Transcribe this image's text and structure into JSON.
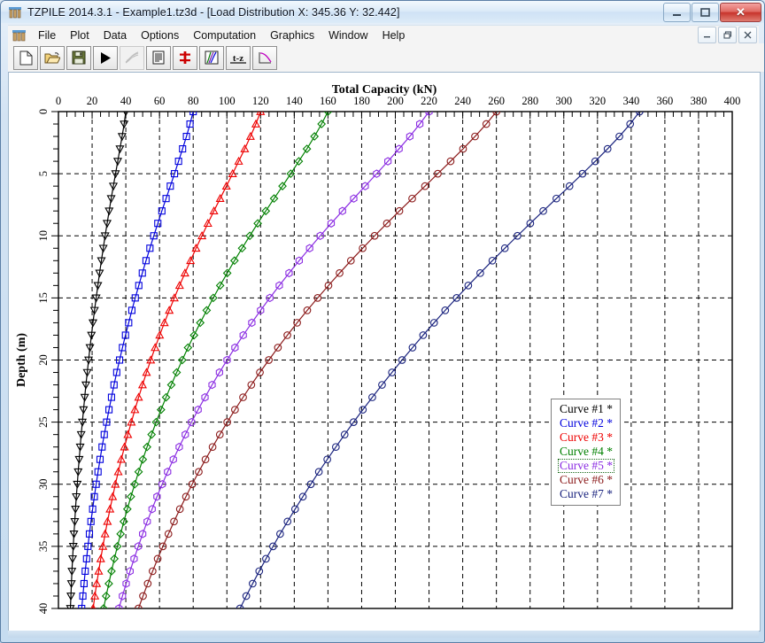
{
  "window": {
    "title": "TZPILE 2014.3.1 - Example1.tz3d - [Load Distribution X: 345.36 Y: 32.442]",
    "app_icon": "tzpile-app-icon",
    "minimize_label": "–",
    "maximize_label": "□",
    "close_label": "✕",
    "mdi_minimize_label": "–",
    "mdi_restore_label": "❐",
    "mdi_close_label": "✕"
  },
  "menu": {
    "items": [
      {
        "label": "File"
      },
      {
        "label": "Plot"
      },
      {
        "label": "Data"
      },
      {
        "label": "Options"
      },
      {
        "label": "Computation"
      },
      {
        "label": "Graphics"
      },
      {
        "label": "Window"
      },
      {
        "label": "Help"
      }
    ]
  },
  "toolbar": {
    "buttons": [
      {
        "icon": "new-file-icon",
        "name": "new-file-button"
      },
      {
        "icon": "open-folder-icon",
        "name": "open-file-button"
      },
      {
        "icon": "save-disk-icon",
        "name": "save-file-button"
      },
      {
        "icon": "run-play-icon",
        "name": "run-computation-button"
      },
      {
        "icon": "curves-disabled-icon",
        "name": "disabled-button"
      },
      {
        "icon": "report-page-icon",
        "name": "report-button"
      },
      {
        "icon": "pile-section-icon",
        "name": "pile-properties-button"
      },
      {
        "icon": "multi-curve-icon",
        "name": "load-distribution-button"
      },
      {
        "icon": "t-z-icon",
        "name": "tz-curve-button"
      },
      {
        "icon": "single-curve-icon",
        "name": "settlement-curve-button"
      }
    ],
    "tz_label": "t-z"
  },
  "chart_data": {
    "type": "line",
    "title": "Total Capacity  (kN)",
    "xlabel": "Total Capacity  (kN)",
    "ylabel": "Depth  (m)",
    "xlim": [
      0,
      400
    ],
    "ylim": [
      0,
      40
    ],
    "y_inverted": true,
    "x_major_step": 20,
    "x_minor_step": 5,
    "y_major_step": 5,
    "y_minor_step": 1,
    "x_ticks": [
      0,
      20,
      40,
      60,
      80,
      100,
      120,
      140,
      160,
      180,
      200,
      220,
      240,
      260,
      280,
      300,
      320,
      340,
      360,
      380,
      400
    ],
    "y_ticks": [
      0,
      5,
      10,
      15,
      20,
      25,
      30,
      35,
      40
    ],
    "grid": "dashed",
    "legend_position": "center-right",
    "legend_selected": "Curve #5 *",
    "series": [
      {
        "name": "Curve #1 *",
        "color": "#000000",
        "marker": "triangle-down",
        "x": [
          40.0,
          39.0,
          37.8,
          36.5,
          35.2,
          33.9,
          32.6,
          31.3,
          30.1,
          28.9,
          27.7,
          26.6,
          25.5,
          24.4,
          23.4,
          22.4,
          21.4,
          20.5,
          19.6,
          18.7,
          17.9,
          17.1,
          16.3,
          15.6,
          14.9,
          14.2,
          13.5,
          12.9,
          12.3,
          11.7,
          11.2,
          10.6,
          10.1,
          9.7,
          9.2,
          8.8,
          8.4,
          8.0,
          7.7,
          7.4,
          7.1
        ],
        "y": [
          0,
          1,
          2,
          3,
          4,
          5,
          6,
          7,
          8,
          9,
          10,
          11,
          12,
          13,
          14,
          15,
          16,
          17,
          18,
          19,
          20,
          21,
          22,
          23,
          24,
          25,
          26,
          27,
          28,
          29,
          30,
          31,
          32,
          33,
          34,
          35,
          36,
          37,
          38,
          39,
          40
        ]
      },
      {
        "name": "Curve #2 *",
        "color": "#0000dd",
        "marker": "square",
        "x": [
          80.0,
          78.1,
          76.0,
          73.7,
          71.3,
          68.9,
          66.4,
          63.9,
          61.4,
          59.0,
          56.6,
          54.3,
          52.0,
          49.8,
          47.7,
          45.6,
          43.6,
          41.7,
          39.8,
          38.0,
          36.3,
          34.6,
          33.0,
          31.5,
          30.0,
          28.6,
          27.2,
          25.9,
          24.7,
          23.5,
          22.4,
          21.3,
          20.3,
          19.3,
          18.4,
          17.5,
          16.7,
          15.9,
          15.2,
          14.5,
          13.8
        ],
        "y": [
          0,
          1,
          2,
          3,
          4,
          5,
          6,
          7,
          8,
          9,
          10,
          11,
          12,
          13,
          14,
          15,
          16,
          17,
          18,
          19,
          20,
          21,
          22,
          23,
          24,
          25,
          26,
          27,
          28,
          29,
          30,
          31,
          32,
          33,
          34,
          35,
          36,
          37,
          38,
          39,
          40
        ]
      },
      {
        "name": "Curve #3 *",
        "color": "#ee0000",
        "marker": "triangle-up",
        "x": [
          120.0,
          117.2,
          114.0,
          110.6,
          107.0,
          103.4,
          99.7,
          96.0,
          92.3,
          88.7,
          85.2,
          81.7,
          78.4,
          75.1,
          71.9,
          68.8,
          65.8,
          62.9,
          60.1,
          57.4,
          54.8,
          52.3,
          49.9,
          47.6,
          45.4,
          43.3,
          41.2,
          39.2,
          37.3,
          35.5,
          33.8,
          32.2,
          30.6,
          29.1,
          27.7,
          26.4,
          25.1,
          23.9,
          22.7,
          21.6,
          20.6
        ],
        "y": [
          0,
          1,
          2,
          3,
          4,
          5,
          6,
          7,
          8,
          9,
          10,
          11,
          12,
          13,
          14,
          15,
          16,
          17,
          18,
          19,
          20,
          21,
          22,
          23,
          24,
          25,
          26,
          27,
          28,
          29,
          30,
          31,
          32,
          33,
          34,
          35,
          36,
          37,
          38,
          39,
          40
        ]
      },
      {
        "name": "Curve #4 *",
        "color": "#008000",
        "marker": "diamond",
        "x": [
          160.0,
          156.2,
          152.0,
          147.5,
          142.7,
          137.9,
          133.0,
          128.0,
          123.1,
          118.3,
          113.6,
          109.0,
          104.5,
          100.2,
          96.0,
          91.9,
          88.0,
          84.2,
          80.5,
          76.9,
          73.5,
          70.2,
          67.0,
          63.9,
          60.9,
          58.0,
          55.3,
          52.6,
          50.1,
          47.6,
          45.3,
          43.0,
          40.9,
          38.8,
          36.9,
          35.0,
          33.2,
          31.5,
          29.9,
          28.3,
          26.8
        ],
        "y": [
          0,
          1,
          2,
          3,
          4,
          5,
          6,
          7,
          8,
          9,
          10,
          11,
          12,
          13,
          14,
          15,
          16,
          17,
          18,
          19,
          20,
          21,
          22,
          23,
          24,
          25,
          26,
          27,
          28,
          29,
          30,
          31,
          32,
          33,
          34,
          35,
          36,
          37,
          38,
          39,
          40
        ]
      },
      {
        "name": "Curve #5 *",
        "color": "#8a2be2",
        "marker": "hexagon",
        "x": [
          220.0,
          214.5,
          208.6,
          202.2,
          195.6,
          188.9,
          182.1,
          175.3,
          168.6,
          161.9,
          155.4,
          149.1,
          142.9,
          136.9,
          131.1,
          125.5,
          120.0,
          114.8,
          109.7,
          104.8,
          100.1,
          95.6,
          91.2,
          87.0,
          82.9,
          79.0,
          75.3,
          71.7,
          68.2,
          64.8,
          61.6,
          58.5,
          55.6,
          52.7,
          50.0,
          47.4,
          44.9,
          42.5,
          40.2,
          38.0,
          35.9
        ],
        "y": [
          0,
          1,
          2,
          3,
          4,
          5,
          6,
          7,
          8,
          9,
          10,
          11,
          12,
          13,
          14,
          15,
          16,
          17,
          18,
          19,
          20,
          21,
          22,
          23,
          24,
          25,
          26,
          27,
          28,
          29,
          30,
          31,
          32,
          33,
          34,
          35,
          36,
          37,
          38,
          39,
          40
        ]
      },
      {
        "name": "Curve #6 *",
        "color": "#8b1a1a",
        "marker": "circle",
        "x": [
          260.0,
          254.0,
          247.3,
          240.2,
          232.8,
          225.2,
          217.6,
          210.0,
          202.4,
          195.0,
          187.7,
          180.6,
          173.6,
          166.9,
          160.3,
          153.9,
          147.7,
          141.7,
          135.9,
          130.3,
          124.9,
          119.6,
          114.5,
          109.6,
          104.8,
          100.2,
          95.8,
          91.5,
          87.3,
          83.3,
          79.4,
          75.7,
          72.1,
          68.6,
          65.3,
          62.0,
          58.9,
          55.9,
          53.0,
          50.2,
          47.5
        ],
        "y": [
          0,
          1,
          2,
          3,
          4,
          5,
          6,
          7,
          8,
          9,
          10,
          11,
          12,
          13,
          14,
          15,
          16,
          17,
          18,
          19,
          20,
          21,
          22,
          23,
          24,
          25,
          26,
          27,
          28,
          29,
          30,
          31,
          32,
          33,
          34,
          35,
          36,
          37,
          38,
          39,
          40
        ]
      },
      {
        "name": "Curve #7 *",
        "color": "#1a237e",
        "marker": "circle",
        "x": [
          345.0,
          339.4,
          333.0,
          326.0,
          318.7,
          311.1,
          303.4,
          295.6,
          287.8,
          280.1,
          272.5,
          265.0,
          257.6,
          250.4,
          243.3,
          236.4,
          229.6,
          223.0,
          216.5,
          210.2,
          204.0,
          198.0,
          192.1,
          186.3,
          180.7,
          175.2,
          169.9,
          164.7,
          159.6,
          154.6,
          149.8,
          145.1,
          140.5,
          136.0,
          131.6,
          127.4,
          123.2,
          119.2,
          115.3,
          111.5,
          107.8
        ],
        "y": [
          0,
          1,
          2,
          3,
          4,
          5,
          6,
          7,
          8,
          9,
          10,
          11,
          12,
          13,
          14,
          15,
          16,
          17,
          18,
          19,
          20,
          21,
          22,
          23,
          24,
          25,
          26,
          27,
          28,
          29,
          30,
          31,
          32,
          33,
          34,
          35,
          36,
          37,
          38,
          39,
          40
        ]
      }
    ]
  }
}
